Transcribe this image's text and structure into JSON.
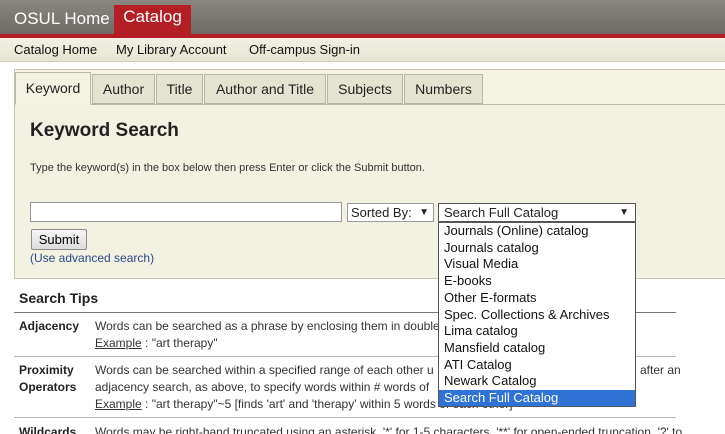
{
  "topbar": {
    "home_label": "OSUL Home",
    "catalog_label": "Catalog"
  },
  "subnav": [
    "Catalog Home",
    "My Library Account",
    "Off-campus Sign-in"
  ],
  "tabs": [
    "Keyword",
    "Author",
    "Title",
    "Author and Title",
    "Subjects",
    "Numbers"
  ],
  "search": {
    "title": "Keyword Search",
    "instructions": "Type the keyword(s) in the box below then press Enter or click the Submit button.",
    "keyword_value": "",
    "sort_label": "Sorted By:",
    "scope_value": "Search Full Catalog",
    "submit_label": "Submit",
    "advanced_link": "(Use advanced search)"
  },
  "tips": {
    "title": "Search Tips",
    "items": [
      {
        "term": "Adjacency",
        "line1": "Words can be searched as a phrase by enclosing them in double",
        "example_label": "Example",
        "example_text": " : \"art therapy\""
      },
      {
        "term_line1": "Proximity",
        "term_line2": "Operators",
        "line1": "Words can be searched within a specified range of each other u",
        "line1_right": "after an",
        "line2": "adjacency search, as above, to specify words within # words of",
        "example_label": "Example",
        "example_text": " : \"art therapy\"~5 [finds 'art' and 'therapy' within 5 words of each other]"
      },
      {
        "term": "Wildcards",
        "line1": "Words may be right-hand truncated using an asterisk. '*' for 1-5 characters, '**' for open-ended truncation. '?' to"
      }
    ]
  },
  "dropdown": {
    "options": [
      "Journals (Online) catalog",
      "Journals catalog",
      "Visual Media",
      "E-books",
      "Other E-formats",
      "Spec. Collections & Archives",
      "Lima catalog",
      "Mansfield catalog",
      "ATI Catalog",
      "Newark Catalog",
      "Search Full Catalog"
    ],
    "selected_index": 10
  },
  "colors": {
    "brand_red": "#b31f24",
    "panel_bg": "#f3f2e3",
    "selection_blue": "#2f73d6",
    "link_blue": "#2b4b8a"
  }
}
